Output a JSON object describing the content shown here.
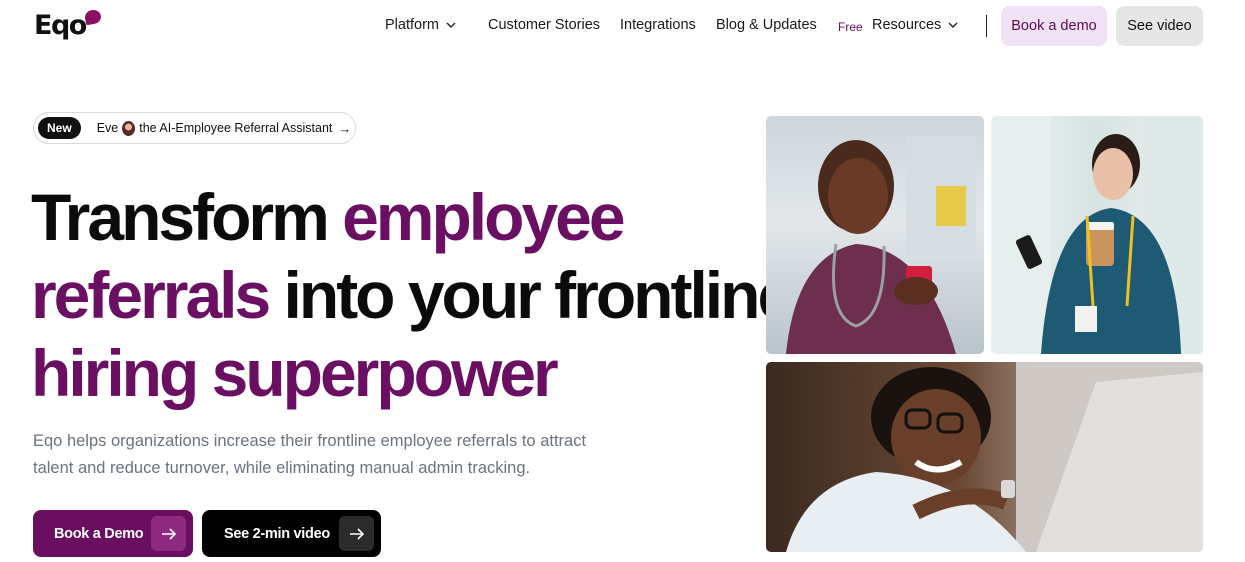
{
  "brand": {
    "name": "Eqo",
    "accent": "#6a0f62"
  },
  "nav": {
    "platform": "Platform",
    "customer_stories": "Customer Stories",
    "integrations": "Integrations",
    "blog": "Blog & Updates",
    "free_tag": "Free",
    "resources": "Resources",
    "book_demo": "Book a demo",
    "see_video": "See video"
  },
  "announcement": {
    "badge": "New",
    "name": "Eve",
    "text": "the AI-Employee Referral Assistant",
    "arrow": "→"
  },
  "hero": {
    "line1_dark": "Transform ",
    "line1_accent": "employee",
    "line2_accent": "referrals",
    "line2_dark": " into your frontline",
    "line3_accent": "hiring superpower",
    "subtext": "Eqo helps organizations increase their frontline employee referrals to attract talent and reduce turnover, while eliminating manual admin tracking."
  },
  "cta": {
    "book_demo": "Book a Demo",
    "see_video": "See 2-min video"
  },
  "images": {
    "photo1": "nurse-with-phone",
    "photo2": "nurse-with-coffee-and-phone",
    "photo3": "smiling-nurse-at-laptop"
  }
}
